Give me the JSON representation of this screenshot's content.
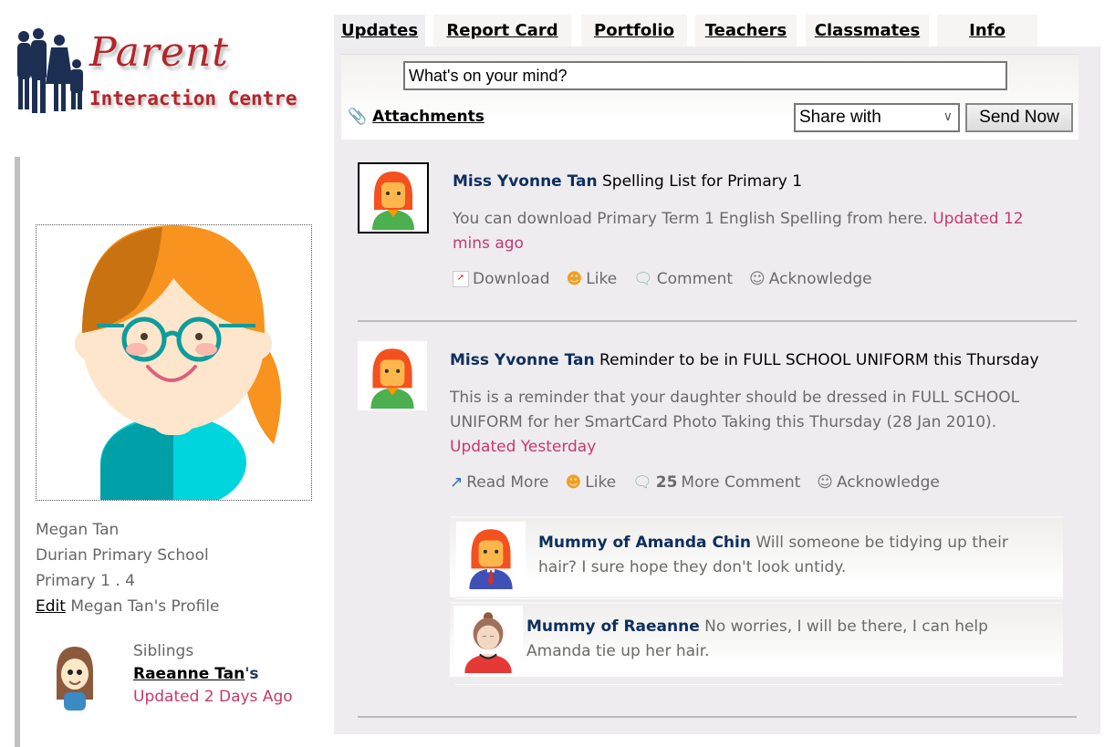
{
  "logo": {
    "line1": "Parent",
    "line2": "Interaction Centre"
  },
  "tabs": [
    {
      "label": "Updates",
      "active": true
    },
    {
      "label": "Report Card",
      "active": false
    },
    {
      "label": "Portfolio",
      "active": false
    },
    {
      "label": "Teachers",
      "active": false
    },
    {
      "label": "Classmates",
      "active": false
    },
    {
      "label": "Info",
      "active": false
    }
  ],
  "composer": {
    "placeholder": "What's on your mind?",
    "attachments_label": "Attachments",
    "share_with": "Share with",
    "send_label": "Send Now"
  },
  "profile": {
    "name": "Megan Tan",
    "school": "Durian Primary School",
    "class": "Primary 1 . 4",
    "edit_label": "Edit",
    "edit_suffix": "Megan Tan's Profile",
    "siblings_label": "Siblings",
    "sibling_name": "Raeanne Tan",
    "sibling_possessive": "'s",
    "sibling_updated": "Updated 2 Days Ago"
  },
  "posts": [
    {
      "author": "Miss Yvonne Tan",
      "title": "Spelling List for Primary 1",
      "text": "You can download Primary Term 1 English Spelling from here.",
      "updated": "Updated 12 mins ago",
      "actions": {
        "primary": "Download",
        "like": "Like",
        "comment": "Comment",
        "acknowledge": "Acknowledge"
      }
    },
    {
      "author": "Miss Yvonne Tan",
      "title": "Reminder to be in FULL SCHOOL UNIFORM this Thursday",
      "text": "This is a reminder that your daughter should be dressed in FULL SCHOOL UNIFORM for her SmartCard Photo Taking this Thursday (28 Jan 2010).",
      "updated": "Updated Yesterday",
      "actions": {
        "primary": "Read More",
        "like": "Like",
        "comment_count": "25",
        "comment": "More Comment",
        "acknowledge": "Acknowledge"
      },
      "comments": [
        {
          "author": "Mummy of Amanda Chin",
          "text": "Will someone be tidying up their hair? I sure hope they don't look untidy."
        },
        {
          "author": "Mummy of Raeanne",
          "text": "No worries, I will be there, I can help Amanda tie up her hair."
        }
      ]
    }
  ],
  "colors": {
    "accent_pink": "#c8386c",
    "author_navy": "#0d2f5d",
    "logo_red": "#b2262b",
    "panel_bg": "#eeecef"
  }
}
